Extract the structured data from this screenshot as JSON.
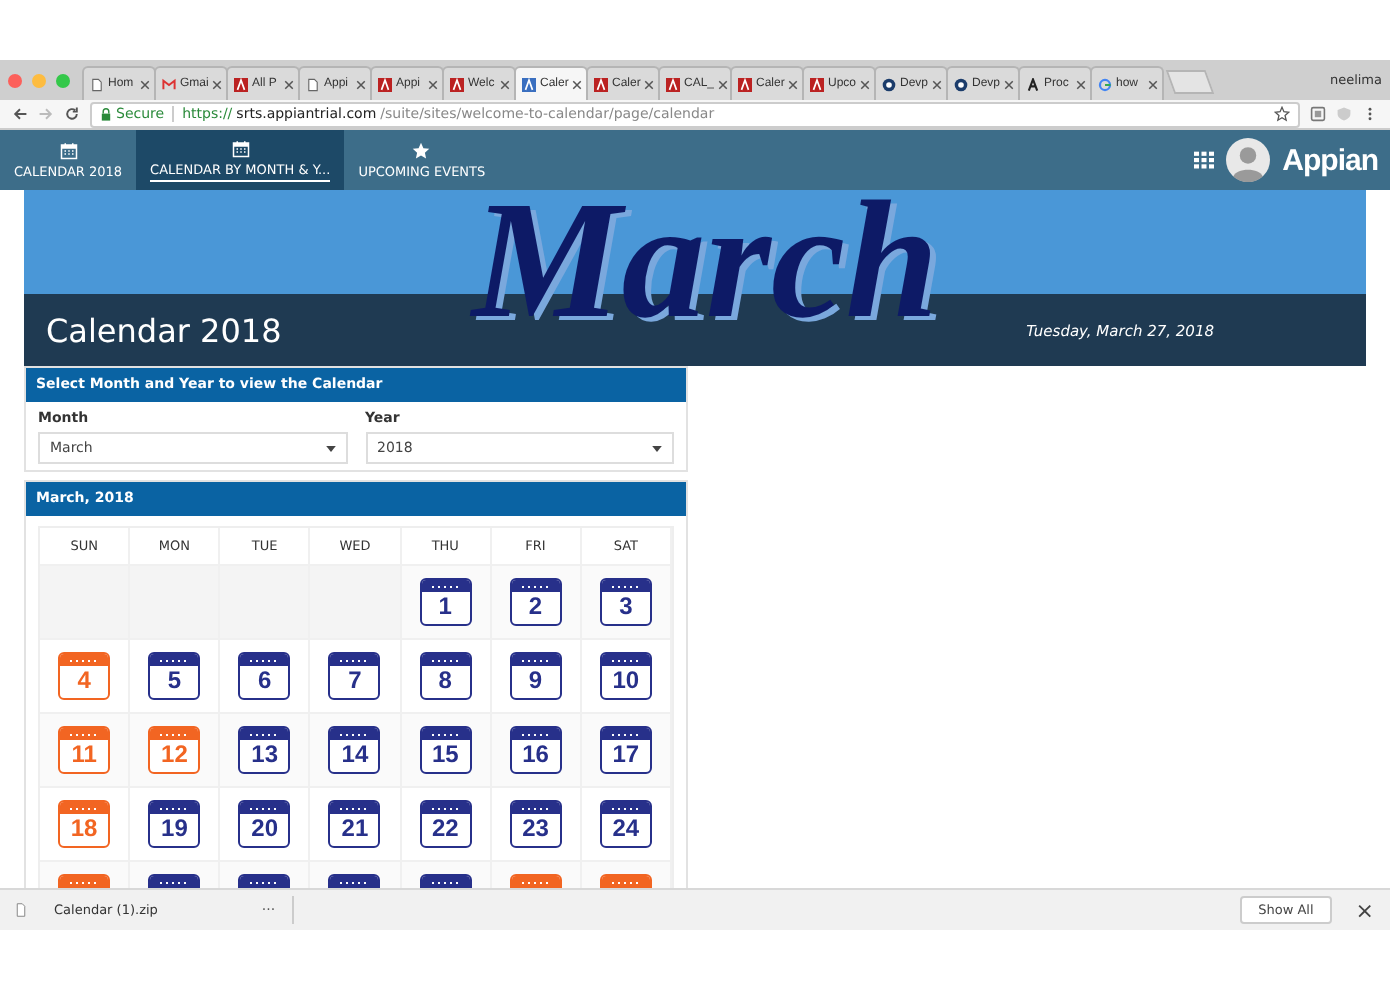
{
  "browser": {
    "tabs": [
      {
        "label": "Hom",
        "selected": false
      },
      {
        "label": "Gmai",
        "selected": false
      },
      {
        "label": "All P",
        "selected": false
      },
      {
        "label": "Appi",
        "selected": false
      },
      {
        "label": "Appi",
        "selected": false
      },
      {
        "label": "Welc",
        "selected": false
      },
      {
        "label": "Caler",
        "selected": true
      },
      {
        "label": "Caler",
        "selected": false
      },
      {
        "label": "CAL_",
        "selected": false
      },
      {
        "label": "Caler",
        "selected": false
      },
      {
        "label": "Upco",
        "selected": false
      },
      {
        "label": "Devp",
        "selected": false
      },
      {
        "label": "Devp",
        "selected": false
      },
      {
        "label": "Proc",
        "selected": false
      },
      {
        "label": "how",
        "selected": false
      }
    ],
    "profile": "neelima",
    "secure_label": "Secure",
    "url_scheme": "https://",
    "url_host": "srts.appiantrial.com",
    "url_path": "/suite/sites/welcome-to-calendar/page/calendar"
  },
  "app_nav": {
    "tabs": [
      {
        "label": "CALENDAR 2018",
        "selected": false
      },
      {
        "label": "CALENDAR BY MONTH & Y...",
        "selected": true
      },
      {
        "label": "UPCOMING EVENTS",
        "selected": false
      }
    ],
    "brand": "Appian"
  },
  "banner": {
    "month_art": "March",
    "title": "Calendar 2018",
    "date": "Tuesday, March 27, 2018"
  },
  "selector": {
    "header": "Select Month and Year to view the Calendar",
    "fields": [
      {
        "label": "Month",
        "value": "March"
      },
      {
        "label": "Year",
        "value": "2018"
      }
    ]
  },
  "calendar": {
    "header": "March, 2018",
    "weekdays": [
      "SUN",
      "MON",
      "TUE",
      "WED",
      "THU",
      "FRI",
      "SAT"
    ],
    "weeks": [
      [
        {
          "kind": "empty"
        },
        {
          "kind": "empty"
        },
        {
          "kind": "empty"
        },
        {
          "kind": "empty"
        },
        {
          "kind": "day",
          "day": "1",
          "color": "#27308a"
        },
        {
          "kind": "day",
          "day": "2",
          "color": "#27308a"
        },
        {
          "kind": "day",
          "day": "3",
          "color": "#27308a"
        }
      ],
      [
        {
          "kind": "day",
          "day": "4",
          "color": "#f26522"
        },
        {
          "kind": "day",
          "day": "5",
          "color": "#27308a"
        },
        {
          "kind": "day",
          "day": "6",
          "color": "#27308a"
        },
        {
          "kind": "day",
          "day": "7",
          "color": "#27308a"
        },
        {
          "kind": "day",
          "day": "8",
          "color": "#27308a"
        },
        {
          "kind": "day",
          "day": "9",
          "color": "#27308a"
        },
        {
          "kind": "day",
          "day": "10",
          "color": "#27308a"
        }
      ],
      [
        {
          "kind": "day",
          "day": "11",
          "color": "#f26522"
        },
        {
          "kind": "day",
          "day": "12",
          "color": "#f26522"
        },
        {
          "kind": "day",
          "day": "13",
          "color": "#27308a"
        },
        {
          "kind": "day",
          "day": "14",
          "color": "#27308a"
        },
        {
          "kind": "day",
          "day": "15",
          "color": "#27308a"
        },
        {
          "kind": "day",
          "day": "16",
          "color": "#27308a"
        },
        {
          "kind": "day",
          "day": "17",
          "color": "#27308a"
        }
      ],
      [
        {
          "kind": "day",
          "day": "18",
          "color": "#f26522"
        },
        {
          "kind": "day",
          "day": "19",
          "color": "#27308a"
        },
        {
          "kind": "day",
          "day": "20",
          "color": "#27308a"
        },
        {
          "kind": "day",
          "day": "21",
          "color": "#27308a"
        },
        {
          "kind": "day",
          "day": "22",
          "color": "#27308a"
        },
        {
          "kind": "day",
          "day": "23",
          "color": "#27308a"
        },
        {
          "kind": "day",
          "day": "24",
          "color": "#27308a"
        }
      ],
      [
        {
          "kind": "day",
          "color": "#f26522"
        },
        {
          "kind": "day",
          "color": "#27308a"
        },
        {
          "kind": "day",
          "color": "#27308a"
        },
        {
          "kind": "day",
          "color": "#27308a"
        },
        {
          "kind": "day",
          "color": "#27308a"
        },
        {
          "kind": "day",
          "color": "#f26522"
        },
        {
          "kind": "day",
          "color": "#f26522"
        }
      ]
    ]
  },
  "download_bar": {
    "file": "Calendar (1).zip",
    "more": "···",
    "button": "Show All",
    "close": "×"
  }
}
